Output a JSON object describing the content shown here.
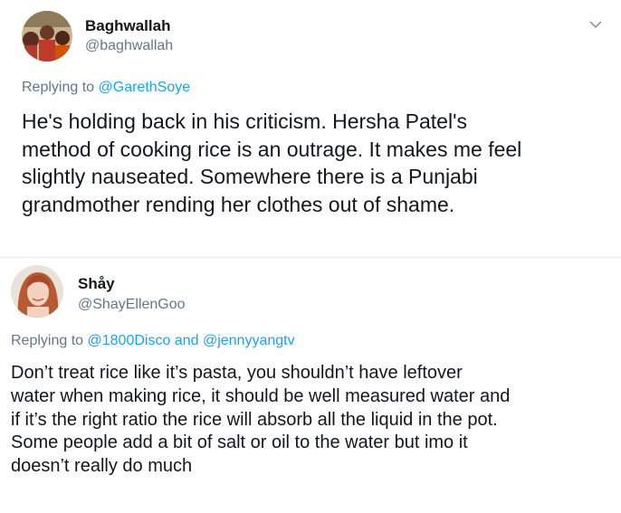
{
  "tweets": [
    {
      "display_name": "Baghwallah",
      "handle": "@baghwallah",
      "replying_to_label": "Replying to",
      "replying_to": [
        "@GarethSoye"
      ],
      "text_lines": [
        "He's holding back in his criticism. Hersha Patel's",
        "method of cooking rice is an outrage. It makes me feel",
        "slightly nauseated. Somewhere there is a Punjabi",
        "grandmother rending her clothes out of shame."
      ],
      "menu_icon": "chevron-down-icon"
    },
    {
      "display_name": "Shåy",
      "handle": "@ShayEllenGoo",
      "replying_to_label": "Replying to",
      "replying_to": [
        "@1800Disco",
        "@jennyyangtv"
      ],
      "joiner": "and",
      "text_lines": [
        "Don’t treat rice like it’s pasta, you shouldn’t have leftover",
        "water when making rice, it should be well measured water and",
        "if it’s the right ratio the rice will absorb all the liquid in the pot.",
        "Some people add a bit of salt or oil to the water but imo it",
        "doesn’t really do much"
      ]
    }
  ],
  "colors": {
    "text": "#14171a",
    "secondary": "#657786",
    "link": "#1da1f2",
    "divider": "#e6ecf0"
  }
}
